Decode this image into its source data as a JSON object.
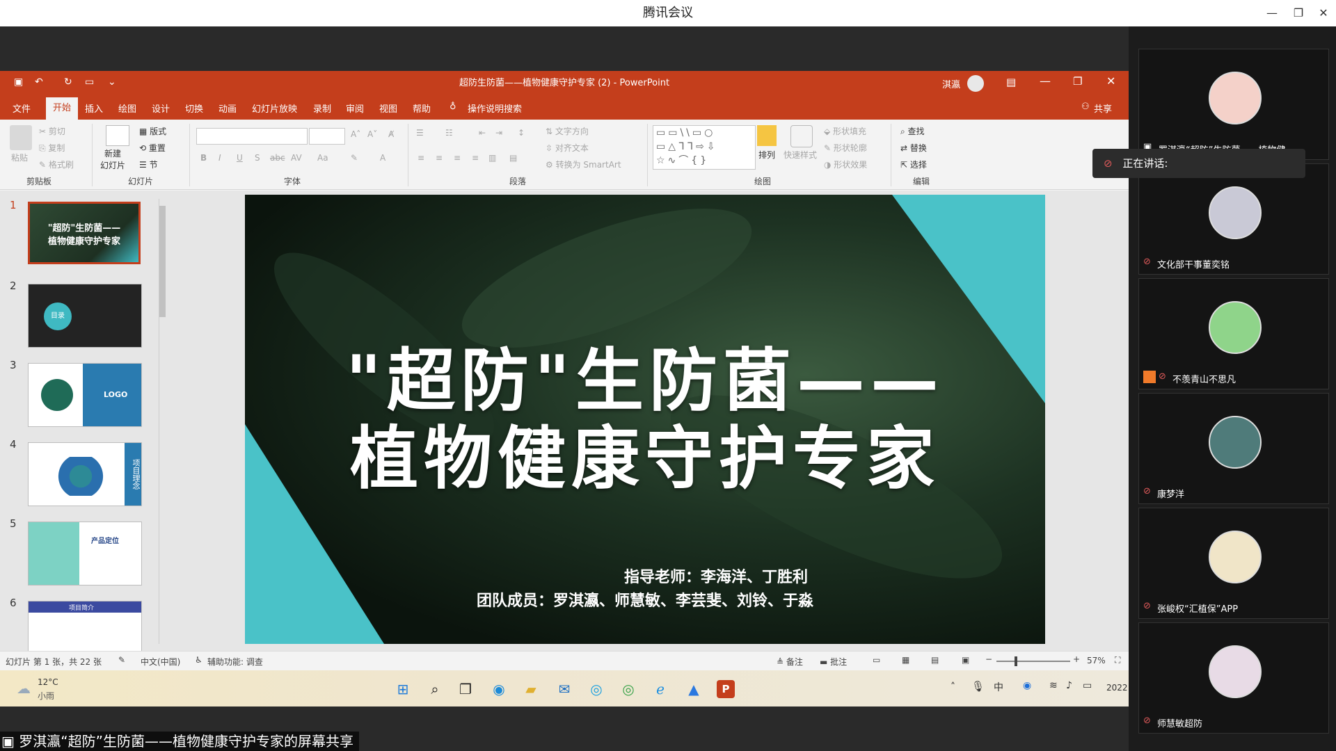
{
  "meeting_app": {
    "title": "腾讯会议"
  },
  "powerpoint": {
    "doc_title": "超防生防菌——植物健康守护专家 (2)  -  PowerPoint",
    "user": "淇瀛",
    "share_label": "共享",
    "menu": [
      "文件",
      "开始",
      "插入",
      "绘图",
      "设计",
      "切换",
      "动画",
      "幻灯片放映",
      "录制",
      "审阅",
      "视图",
      "帮助"
    ],
    "tell_me": "操作说明搜索",
    "ribbon": {
      "clipboard": {
        "paste": "粘贴",
        "cut": "剪切",
        "copy": "复制",
        "format_painter": "格式刷",
        "group": "剪贴板"
      },
      "slides": {
        "new_slide": "新建\n幻灯片",
        "layout": "版式",
        "reset": "重置",
        "section": "节",
        "group": "幻灯片"
      },
      "font": {
        "group": "字体"
      },
      "paragraph": {
        "text_direction": "文字方向",
        "align_text": "对齐文本",
        "smartart": "转换为 SmartArt",
        "group": "段落"
      },
      "drawing": {
        "arrange": "排列",
        "quick_styles": "快速样式",
        "shape_fill": "形状填充",
        "shape_outline": "形状轮廓",
        "shape_effects": "形状效果",
        "group": "绘图"
      },
      "editing": {
        "find": "查找",
        "replace": "替换",
        "select": "选择",
        "group": "编辑"
      }
    },
    "thumbnails": [
      {
        "num": "1",
        "title": "\"超防\"生防菌——\n植物健康守护专家"
      },
      {
        "num": "2",
        "title": "目录"
      },
      {
        "num": "3",
        "title": "LOGO"
      },
      {
        "num": "4",
        "title": "项目理念"
      },
      {
        "num": "5",
        "title": "产品定位"
      },
      {
        "num": "6",
        "title": "项目简介"
      }
    ],
    "slide": {
      "title_line1": "\"超防\"生防菌——",
      "title_line2": "植物健康守护专家",
      "advisor": "指导老师：李海洋、丁胜利",
      "team": "团队成员：罗淇瀛、师慧敏、李芸斐、刘铃、于淼"
    },
    "status": {
      "slide_count": "幻灯片 第 1 张，共 22 张",
      "language": "中文(中国)",
      "accessibility": "辅助功能: 调查",
      "notes": "备注",
      "comments": "批注",
      "zoom": "57%"
    }
  },
  "taskbar": {
    "weather_temp": "12°C",
    "weather_desc": "小雨",
    "clock": "2022"
  },
  "share_caption": "罗淇瀛“超防”生防菌——植物健康守护专家的屏幕共享",
  "speaking": {
    "label": "正在讲话:"
  },
  "participants": [
    {
      "name": "罗淇瀛“超防”生防菌——植物健...",
      "avatar_color": "#f4d1c9"
    },
    {
      "name": "文化部干事董奕铭",
      "avatar_color": "#c9c9d6"
    },
    {
      "name": "不羡青山不思凡",
      "avatar_color": "#8fd48a"
    },
    {
      "name": "康梦洋",
      "avatar_color": "#4f7b7a"
    },
    {
      "name": "张峻权“汇植保”APP",
      "avatar_color": "#f0e5c8"
    },
    {
      "name": "师慧敏超防",
      "avatar_color": "#e8dbe6"
    }
  ]
}
